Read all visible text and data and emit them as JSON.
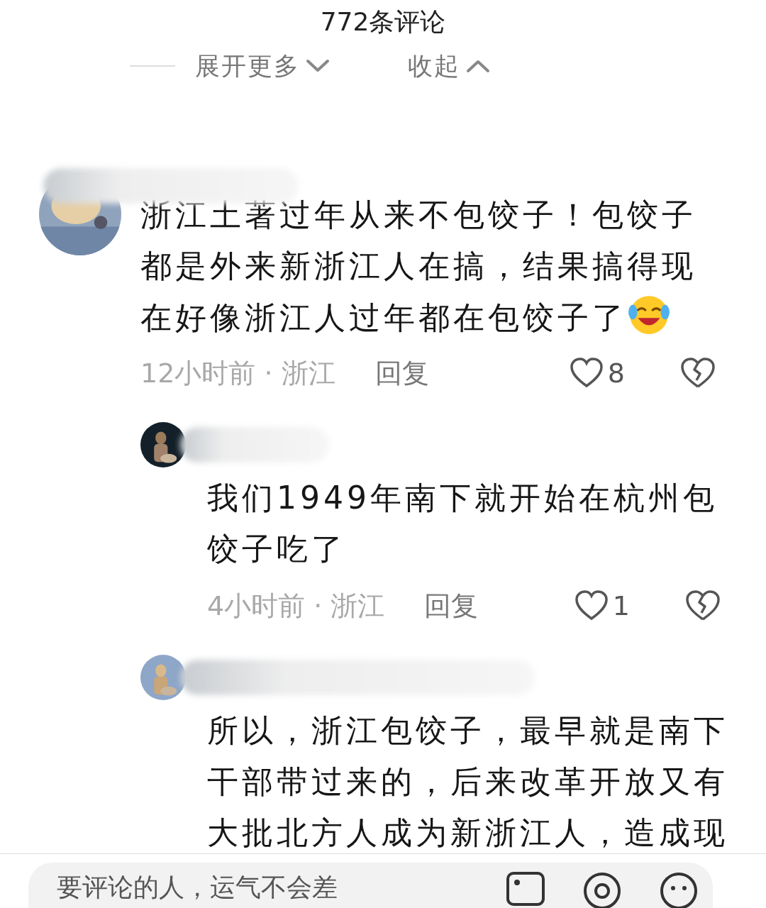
{
  "header": {
    "title": "772条评论"
  },
  "thread_controls": [
    {
      "label": "展开更多",
      "kind": "expand"
    },
    {
      "label": "收起",
      "kind": "collapse"
    }
  ],
  "comments": [
    {
      "text": "浙江土著过年从来不包饺子！包饺子都是外来新浙江人在搞，结果搞得现在好像浙江人过年都在包饺子了",
      "trailing_emoji": true,
      "meta": "12小时前 · 浙江",
      "reply_label": "回复",
      "likes": "8",
      "liked": false,
      "replies": [
        {
          "text": "我们1949年南下就开始在杭州包饺子吃了",
          "meta": "4小时前 · 浙江",
          "reply_label": "回复",
          "likes": "1",
          "liked": false
        },
        {
          "text": "所以，浙江包饺子，最早就是南下干部带过来的，后来改革开放又有大批北方人成为新浙江人，造成现"
        }
      ]
    }
  ],
  "composer": {
    "placeholder": "要评论的人，运气不会差"
  }
}
